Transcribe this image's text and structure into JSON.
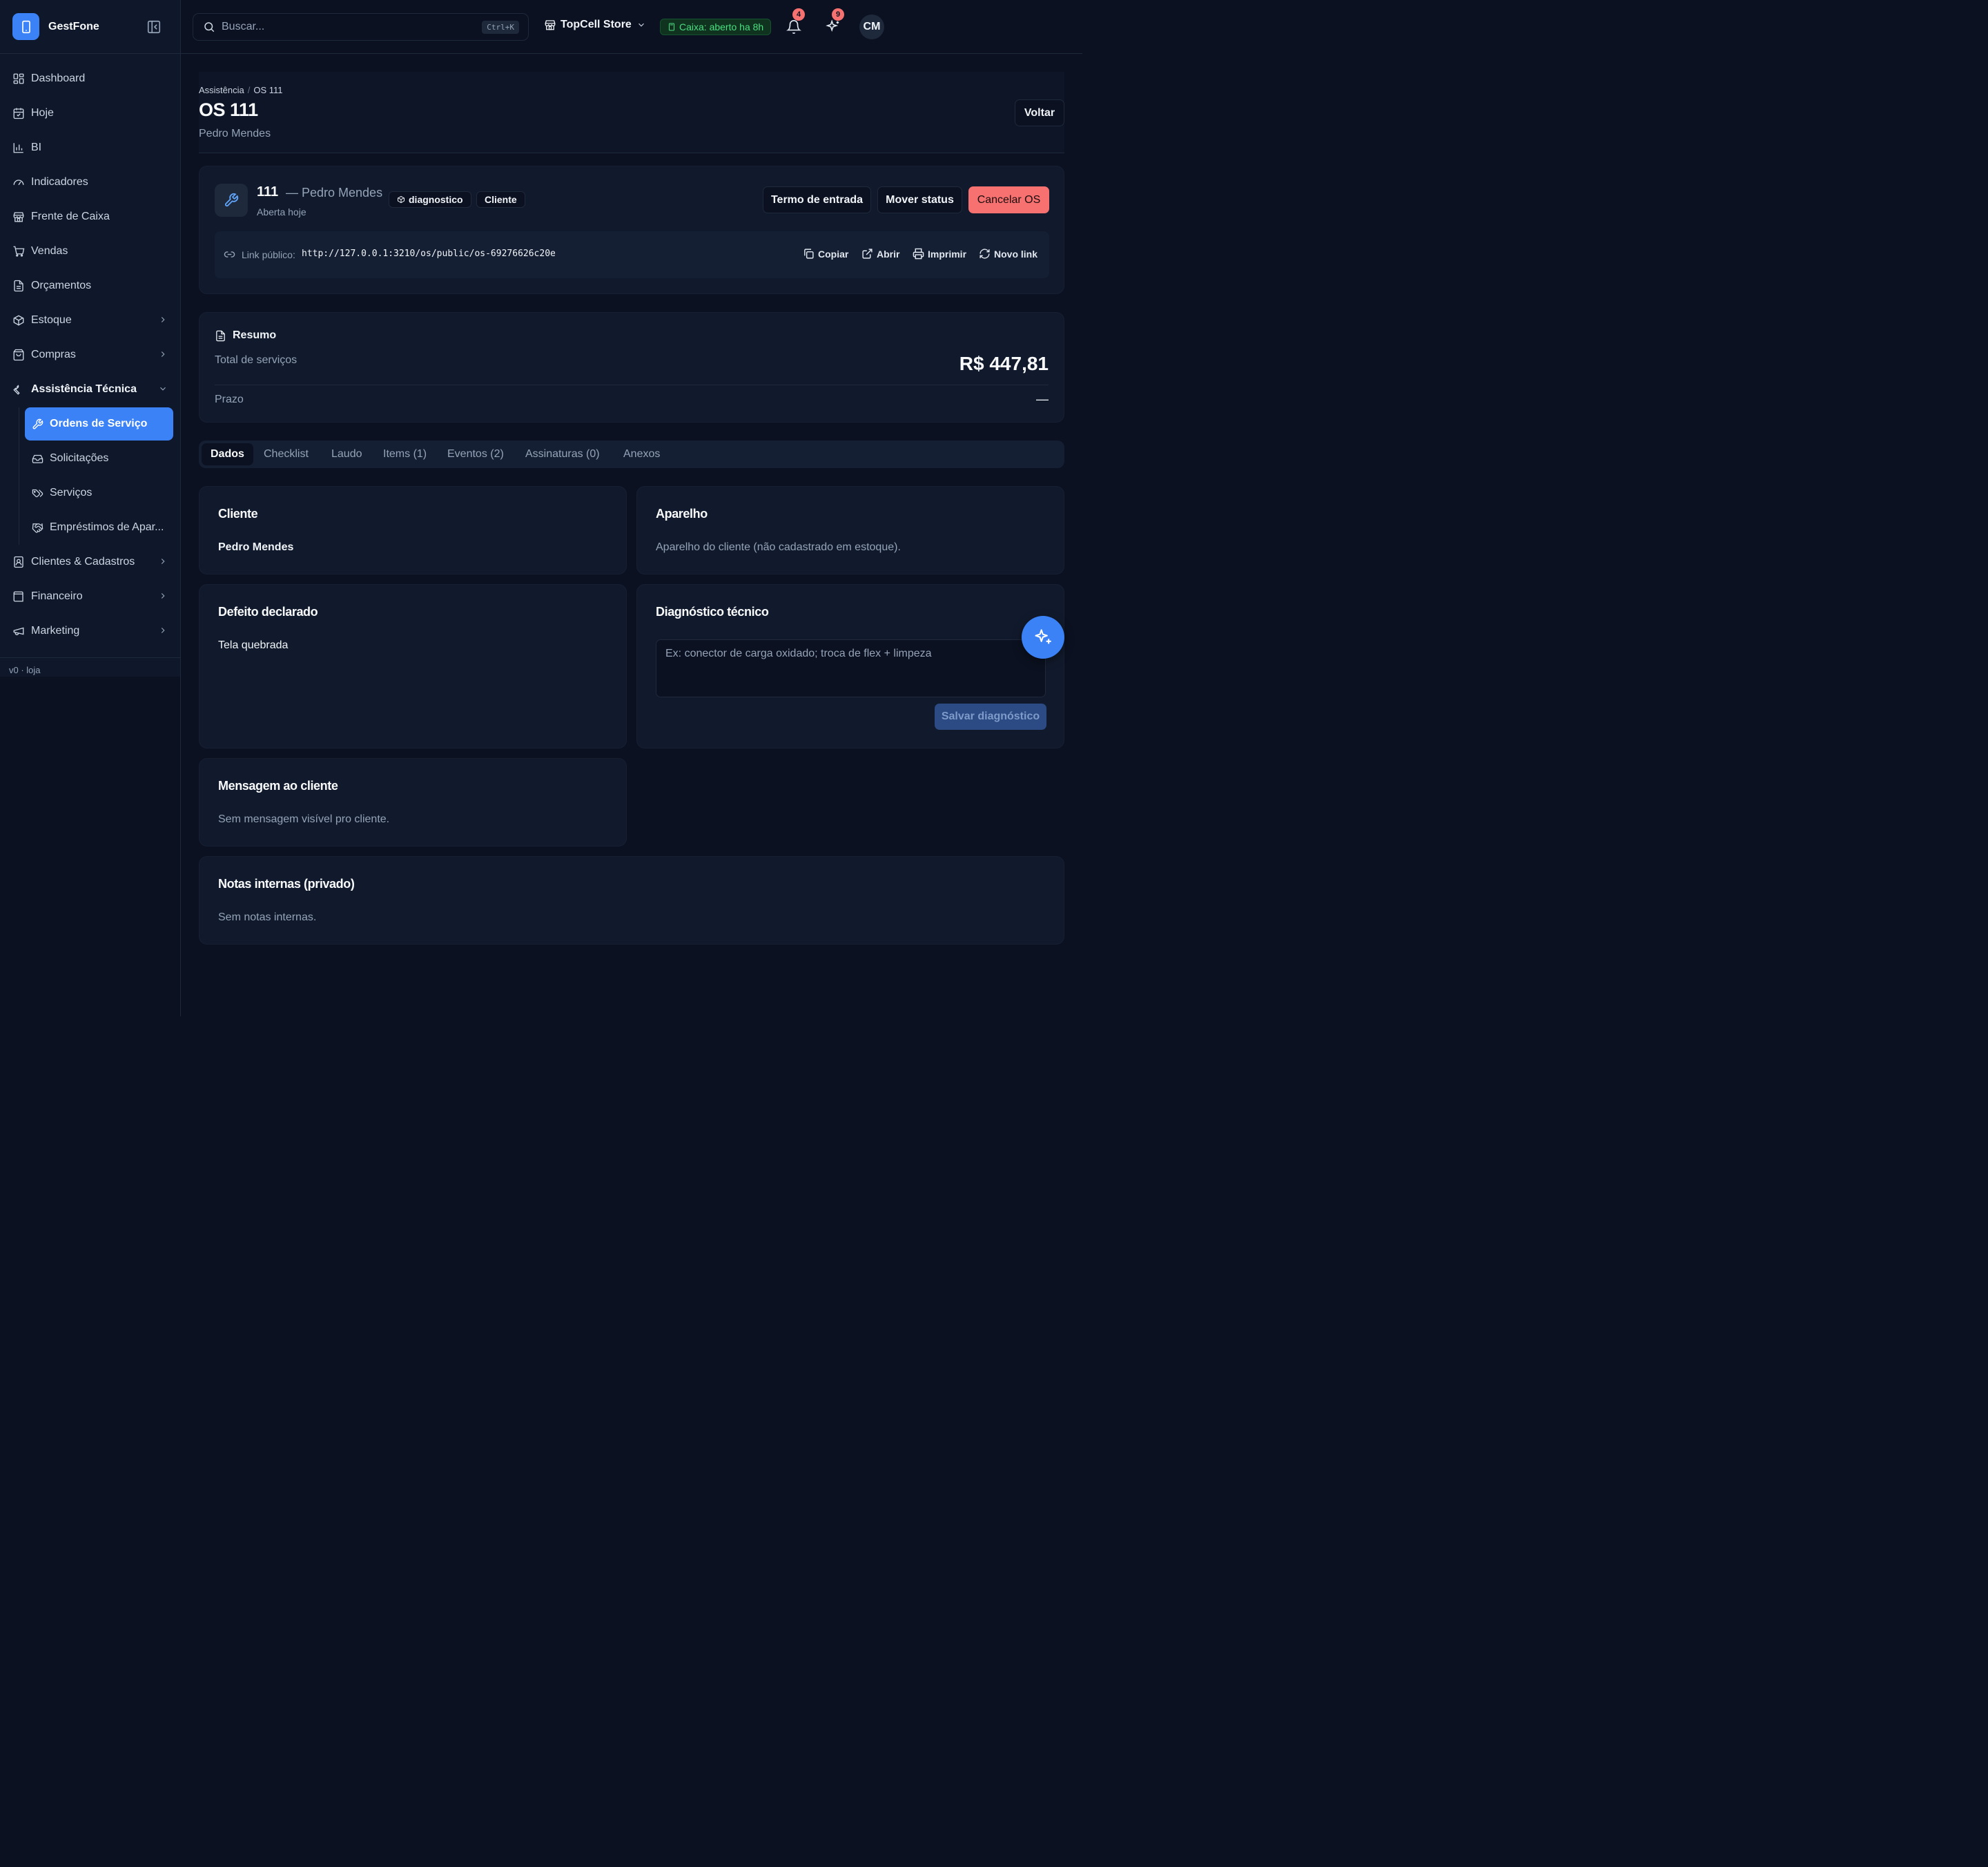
{
  "app": {
    "name": "GestFone",
    "version": "v0 · loja"
  },
  "sidebar": {
    "items": [
      {
        "label": "Dashboard",
        "icon": "dashboard-icon"
      },
      {
        "label": "Hoje",
        "icon": "calendar-icon"
      },
      {
        "label": "BI",
        "icon": "bar-chart-icon"
      },
      {
        "label": "Indicadores",
        "icon": "gauge-icon"
      },
      {
        "label": "Frente de Caixa",
        "icon": "store-icon"
      },
      {
        "label": "Vendas",
        "icon": "cart-icon"
      },
      {
        "label": "Orçamentos",
        "icon": "file-text-icon"
      },
      {
        "label": "Estoque",
        "icon": "package-icon"
      },
      {
        "label": "Compras",
        "icon": "shopping-bag-icon"
      },
      {
        "label": "Assistência Técnica",
        "icon": "wrench-icon"
      },
      {
        "label": "Clientes & Cadastros",
        "icon": "contact-icon"
      },
      {
        "label": "Financeiro",
        "icon": "wallet-icon"
      },
      {
        "label": "Marketing",
        "icon": "megaphone-icon"
      }
    ],
    "sub_items": [
      {
        "label": "Ordens de Serviço",
        "icon": "wrench-icon"
      },
      {
        "label": "Solicitações",
        "icon": "inbox-icon"
      },
      {
        "label": "Serviços",
        "icon": "tags-icon"
      },
      {
        "label": "Empréstimos de Apar...",
        "icon": "handshake-icon"
      }
    ]
  },
  "topbar": {
    "search_placeholder": "Buscar...",
    "search_shortcut": "Ctrl+K",
    "store": "TopCell Store",
    "caixa": "Caixa: aberto ha 8h",
    "notifications_count": "4",
    "ai_count": "9",
    "avatar_initials": "CM"
  },
  "header": {
    "breadcrumb": [
      "Assistência",
      "OS 111"
    ],
    "title": "OS 111",
    "subtitle": "Pedro Mendes",
    "back_label": "Voltar"
  },
  "os": {
    "number": "111",
    "client_suffix": "— Pedro Mendes",
    "opened": "Aberta hoje",
    "status_chip": "diagnostico",
    "origin_chip": "Cliente",
    "actions": {
      "termo": "Termo de entrada",
      "mover": "Mover status",
      "cancelar": "Cancelar OS"
    },
    "link": {
      "label": "Link público:",
      "url": "http://127.0.0.1:3210/os/public/os-69276626c20e",
      "copy": "Copiar",
      "open": "Abrir",
      "print": "Imprimir",
      "new": "Novo link"
    }
  },
  "resumo": {
    "title": "Resumo",
    "total_label": "Total de serviços",
    "total_value": "R$ 447,81",
    "prazo_label": "Prazo",
    "prazo_value": "—"
  },
  "tabs": [
    "Dados",
    "Checklist",
    "Laudo",
    "Items (1)",
    "Eventos (2)",
    "Assinaturas (0)",
    "Anexos"
  ],
  "sections": {
    "cliente": {
      "title": "Cliente",
      "value": "Pedro Mendes"
    },
    "aparelho": {
      "title": "Aparelho",
      "value": "Aparelho do cliente (não cadastrado em estoque)."
    },
    "defeito": {
      "title": "Defeito declarado",
      "value": "Tela quebrada"
    },
    "diagnostico": {
      "title": "Diagnóstico técnico",
      "placeholder": "Ex: conector de carga oxidado; troca de flex + limpeza",
      "save": "Salvar diagnóstico"
    },
    "mensagem": {
      "title": "Mensagem ao cliente",
      "value": "Sem mensagem visível pro cliente."
    },
    "notas": {
      "title": "Notas internas (privado)",
      "value": "Sem notas internas."
    }
  },
  "colors": {
    "accent": "#3b82f6",
    "danger": "#f87171",
    "success": "#4ade80",
    "background": "#0b1120"
  }
}
